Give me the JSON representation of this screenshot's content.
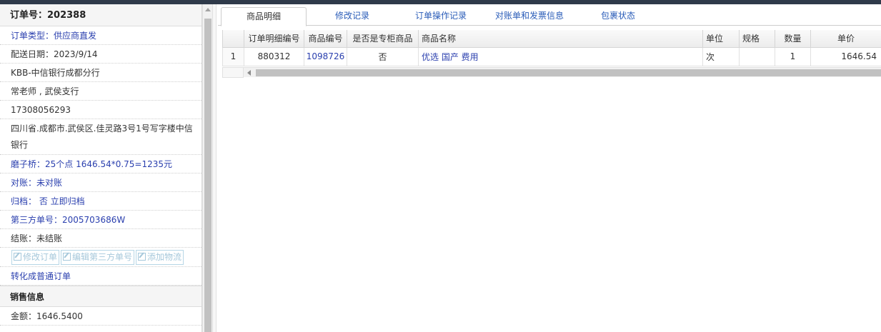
{
  "order": {
    "header": "订单号：202388",
    "type": "订单类型：供应商直发",
    "delivery_date": "配送日期：2023/9/14",
    "company": "KBB-中信银行成都分行",
    "contact": "常老师 , 武侯支行",
    "phone": "17308056293",
    "address": "四川省.成都市.武侯区.佳灵路3号1号写字楼中信银行",
    "note": "磨子桥：25个点 1646.54*0.75=1235元",
    "reconcile": "对账：未对账",
    "archive": "归档： 否 立即归档",
    "third_party": "第三方单号：2005703686W",
    "settlement": "结账：未结账",
    "buttons": [
      "修改订单",
      "编辑第三方单号",
      "添加物流"
    ],
    "convert_link": "转化成普通订单",
    "sales_section": "销售信息",
    "amount": "金额：1646.5400"
  },
  "tabs": [
    "商品明细",
    "修改记录",
    "订单操作记录",
    "对账单和发票信息",
    "包裹状态"
  ],
  "grid": {
    "columns": [
      "",
      "订单明细编号",
      "商品编号",
      "是否是专柜商品",
      "商品名称",
      "单位",
      "规格",
      "数量",
      "单价"
    ],
    "rows": [
      [
        "1",
        "880312",
        "1098726",
        "否",
        "优选 国产 费用",
        "次",
        "",
        "1",
        "1646.54"
      ]
    ]
  },
  "colors": {
    "accent_blue": "#2a3fae",
    "tab_blue": "#2a5cb8",
    "topbar": "#2f3a4a"
  }
}
